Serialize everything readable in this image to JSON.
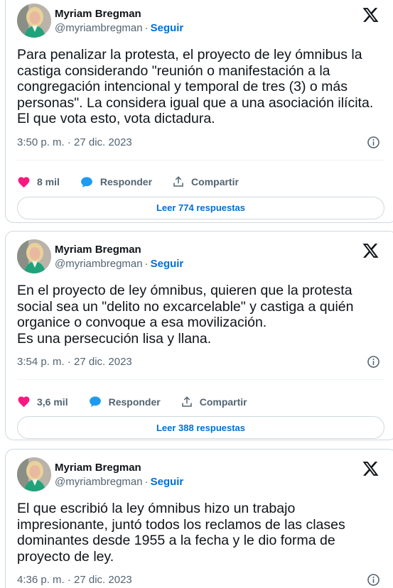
{
  "tweets": [
    {
      "author": {
        "name": "Myriam Bregman",
        "handle": "@myriambregman",
        "follow": "Seguir"
      },
      "text": "Para penalizar la protesta, el proyecto de ley ómnibus la castiga considerando \"reunión o manifestación a la congregación intencional y temporal de tres (3) o más personas\". La considera igual que a una asociación ilícita.\nEl que vota esto, vota dictadura.",
      "time": "3:50 p. m. · 27 dic. 2023",
      "likes": "8 mil",
      "reply_label": "Responder",
      "share_label": "Compartir",
      "read_replies": "Leer 774 respuestas"
    },
    {
      "author": {
        "name": "Myriam Bregman",
        "handle": "@myriambregman",
        "follow": "Seguir"
      },
      "text": "En el proyecto de ley ómnibus, quieren que la protesta social sea un \"delito no excarcelable\" y castiga a quién organice o convoque a esa movilización.\nEs una persecución lisa y llana.",
      "time": "3:54 p. m. · 27 dic. 2023",
      "likes": "3,6 mil",
      "reply_label": "Responder",
      "share_label": "Compartir",
      "read_replies": "Leer 388 respuestas"
    },
    {
      "author": {
        "name": "Myriam Bregman",
        "handle": "@myriambregman",
        "follow": "Seguir"
      },
      "text": "El que escribió la ley ómnibus hizo un trabajo impresionante, juntó todos los reclamos de las clases dominantes desde 1955 a la fecha y le dio forma de proyecto de ley.",
      "time": "4:36 p. m. · 27 dic. 2023"
    }
  ],
  "colors": {
    "accent": "#006fd6",
    "like": "#f91880",
    "muted": "#536471",
    "border": "#cfd9de"
  },
  "icons": {
    "platform": "x-logo-icon",
    "info": "info-icon",
    "like": "heart-icon",
    "reply": "speech-bubble-icon",
    "share": "share-upload-icon"
  }
}
